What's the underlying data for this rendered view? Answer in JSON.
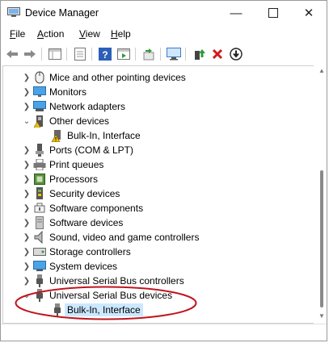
{
  "window": {
    "title": "Device Manager",
    "minimize_icon": "minimize-icon",
    "maximize_icon": "maximize-icon",
    "close_icon": "close-icon"
  },
  "menu": [
    {
      "accel": "F",
      "rest": "ile"
    },
    {
      "accel": "A",
      "rest": "ction"
    },
    {
      "accel": "V",
      "rest": "iew"
    },
    {
      "accel": "H",
      "rest": "elp"
    }
  ],
  "tree": [
    {
      "label": "Mice and other pointing devices",
      "icon": "mouse-icon",
      "expander": "collapsed"
    },
    {
      "label": "Monitors",
      "icon": "monitor-icon",
      "expander": "collapsed"
    },
    {
      "label": "Network adapters",
      "icon": "network-icon",
      "expander": "collapsed"
    },
    {
      "label": "Other devices",
      "icon": "other-devices-icon",
      "expander": "expanded"
    },
    {
      "label": "Bulk-In, Interface",
      "icon": "warning-device-icon",
      "expander": "none"
    },
    {
      "label": "Ports (COM & LPT)",
      "icon": "port-icon",
      "expander": "collapsed"
    },
    {
      "label": "Print queues",
      "icon": "printer-icon",
      "expander": "collapsed"
    },
    {
      "label": "Processors",
      "icon": "processor-icon",
      "expander": "collapsed"
    },
    {
      "label": "Security devices",
      "icon": "security-icon",
      "expander": "collapsed"
    },
    {
      "label": "Software components",
      "icon": "software-component-icon",
      "expander": "collapsed"
    },
    {
      "label": "Software devices",
      "icon": "software-device-icon",
      "expander": "collapsed"
    },
    {
      "label": "Sound, video and game controllers",
      "icon": "sound-icon",
      "expander": "collapsed"
    },
    {
      "label": "Storage controllers",
      "icon": "storage-icon",
      "expander": "collapsed"
    },
    {
      "label": "System devices",
      "icon": "system-icon",
      "expander": "collapsed"
    },
    {
      "label": "Universal Serial Bus controllers",
      "icon": "usb-icon",
      "expander": "collapsed"
    },
    {
      "label": "Universal Serial Bus devices",
      "icon": "usb-icon",
      "expander": "expanded"
    },
    {
      "label": "Bulk-In, Interface",
      "icon": "usb-device-icon",
      "expander": "none",
      "selected": true
    }
  ],
  "colors": {
    "selection": "#cce8ff",
    "annotation": "#c0141e",
    "accent": "#0b5db3"
  }
}
